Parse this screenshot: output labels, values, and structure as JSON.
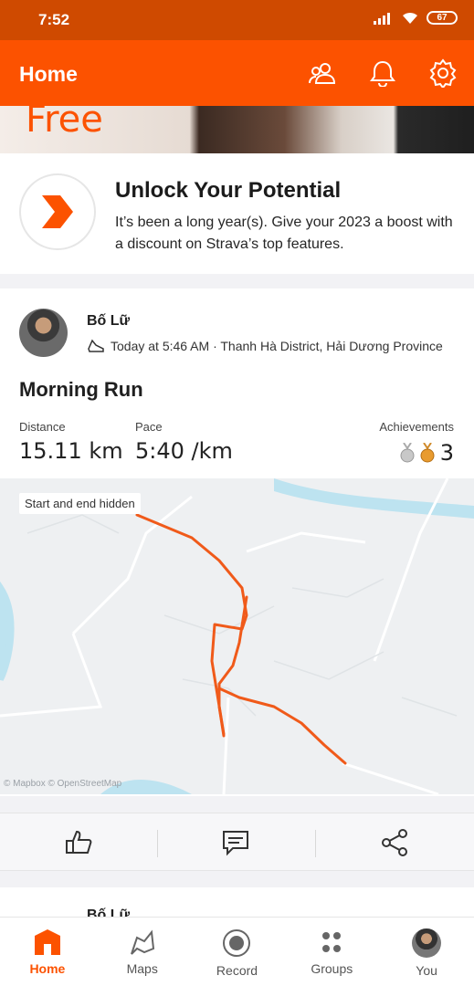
{
  "status_bar": {
    "time": "7:52",
    "battery": "67"
  },
  "app_bar": {
    "title": "Home"
  },
  "promo_banner": {
    "text": "Free"
  },
  "unlock": {
    "heading": "Unlock Your Potential",
    "description": "It’s been a long year(s). Give your 2023 a boost with a discount on Strava’s top features."
  },
  "activity": {
    "athlete": "Bố Lữ",
    "meta": "Today at 5:46 AM · Thanh Hà District, Hải Dương Province",
    "title": "Morning Run",
    "stats": {
      "distance_label": "Distance",
      "distance_value": "15.11 km",
      "pace_label": "Pace",
      "pace_value": "5:40 /km",
      "achievements_label": "Achievements",
      "achievements_value": "3"
    },
    "map": {
      "chip": "Start and end hidden",
      "attribution": "© Mapbox © OpenStreetMap"
    }
  },
  "next_activity": {
    "athlete": "Bố Lữ"
  },
  "bottom_nav": [
    {
      "label": "Home",
      "icon": "home-icon",
      "active": true
    },
    {
      "label": "Maps",
      "icon": "maps-icon",
      "active": false
    },
    {
      "label": "Record",
      "icon": "record-icon",
      "active": false
    },
    {
      "label": "Groups",
      "icon": "groups-icon",
      "active": false
    },
    {
      "label": "You",
      "icon": "avatar",
      "active": false
    }
  ],
  "colors": {
    "brand": "#fc5200",
    "status_bar": "#cf4a00",
    "route": "#f05a1a",
    "water": "#bde3f0"
  }
}
